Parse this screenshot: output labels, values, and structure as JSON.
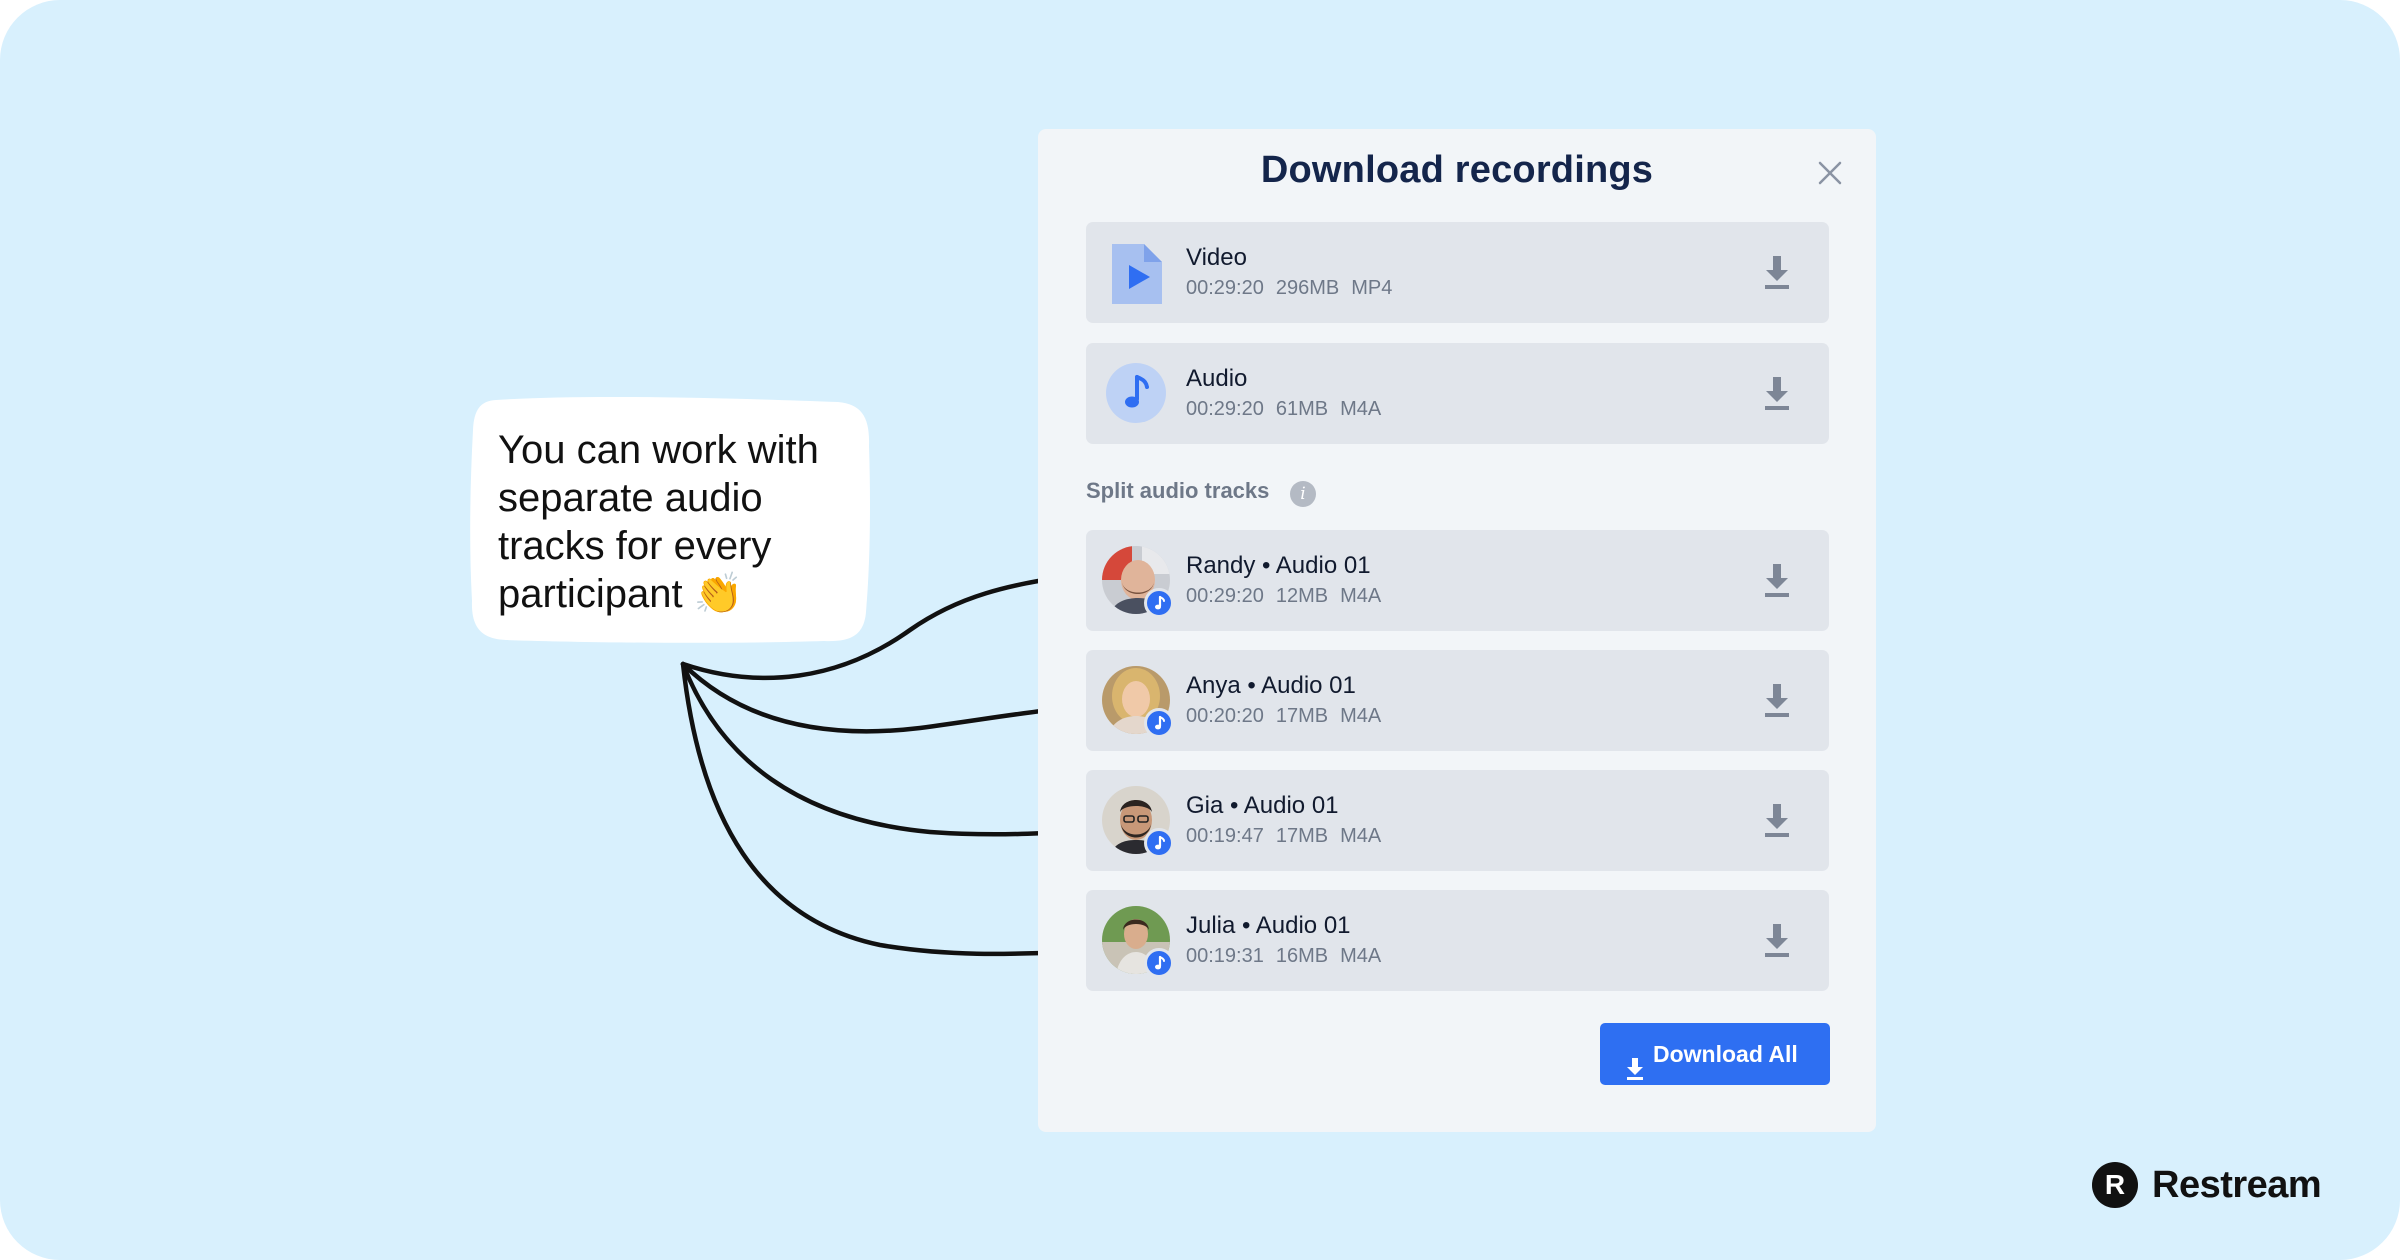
{
  "modal": {
    "title": "Download recordings",
    "close_icon": "close-icon",
    "files": [
      {
        "name": "Video",
        "duration": "00:29:20",
        "size": "296MB",
        "format": "MP4",
        "icon": "video-file-icon"
      },
      {
        "name": "Audio",
        "duration": "00:29:20",
        "size": "61MB",
        "format": "M4A",
        "icon": "audio-note-icon"
      }
    ],
    "section_label": "Split audio tracks",
    "info_glyph": "i",
    "tracks": [
      {
        "name": "Randy • Audio 01",
        "duration": "00:29:20",
        "size": "12MB",
        "format": "M4A"
      },
      {
        "name": "Anya • Audio 01",
        "duration": "00:20:20",
        "size": "17MB",
        "format": "M4A"
      },
      {
        "name": "Gia • Audio 01",
        "duration": "00:19:47",
        "size": "17MB",
        "format": "M4A"
      },
      {
        "name": "Julia • Audio 01",
        "duration": "00:19:31",
        "size": "16MB",
        "format": "M4A"
      }
    ],
    "download_all_label": "Download All"
  },
  "callout": {
    "text": "You can work with separate audio tracks for every participant 👏"
  },
  "brand": {
    "logo_letter": "R",
    "name": "Restream"
  },
  "colors": {
    "background": "#d8f0fd",
    "accent": "#2e6ff2",
    "title": "#14254b"
  }
}
